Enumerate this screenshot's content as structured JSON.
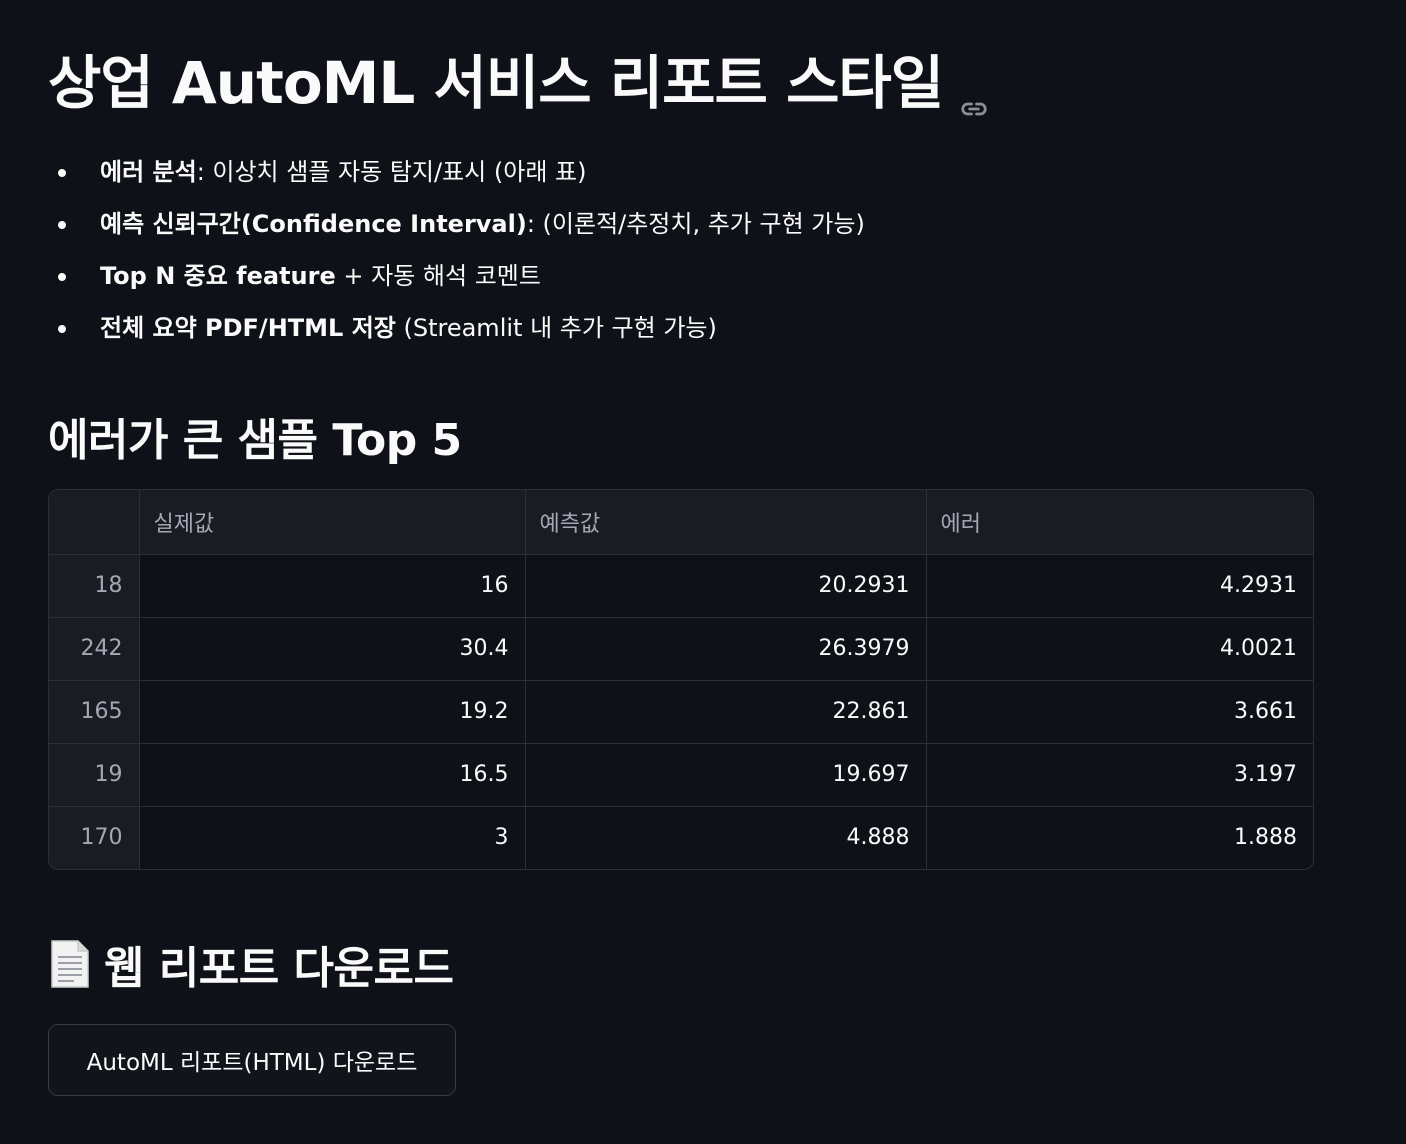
{
  "title": "상업 AutoML 서비스 리포트 스타일",
  "bullets": [
    {
      "bold": "에러 분석",
      "rest": ": 이상치 샘플 자동 탐지/표시 (아래 표)"
    },
    {
      "bold": "예측 신뢰구간(Confidence Interval)",
      "rest": ": (이론적/추정치, 추가 구현 가능)"
    },
    {
      "bold": "Top N 중요 feature",
      "rest": " + 자동 해석 코멘트"
    },
    {
      "bold": "전체 요약 PDF/HTML 저장",
      "rest": " (Streamlit 내 추가 구현 가능)"
    }
  ],
  "top_errors": {
    "heading": "에러가 큰 샘플 Top 5",
    "columns": [
      "",
      "실제값",
      "예측값",
      "에러"
    ],
    "rows": [
      [
        "18",
        "16",
        "20.2931",
        "4.2931"
      ],
      [
        "242",
        "30.4",
        "26.3979",
        "4.0021"
      ],
      [
        "165",
        "19.2",
        "22.861",
        "3.661"
      ],
      [
        "19",
        "16.5",
        "19.697",
        "3.197"
      ],
      [
        "170",
        "3",
        "4.888",
        "1.888"
      ]
    ]
  },
  "download": {
    "heading": "웹 리포트 다운로드",
    "button_label": "AutoML 리포트(HTML) 다운로드"
  },
  "icons": {
    "title_anchor": "link-icon",
    "download_heading": "document-icon"
  }
}
